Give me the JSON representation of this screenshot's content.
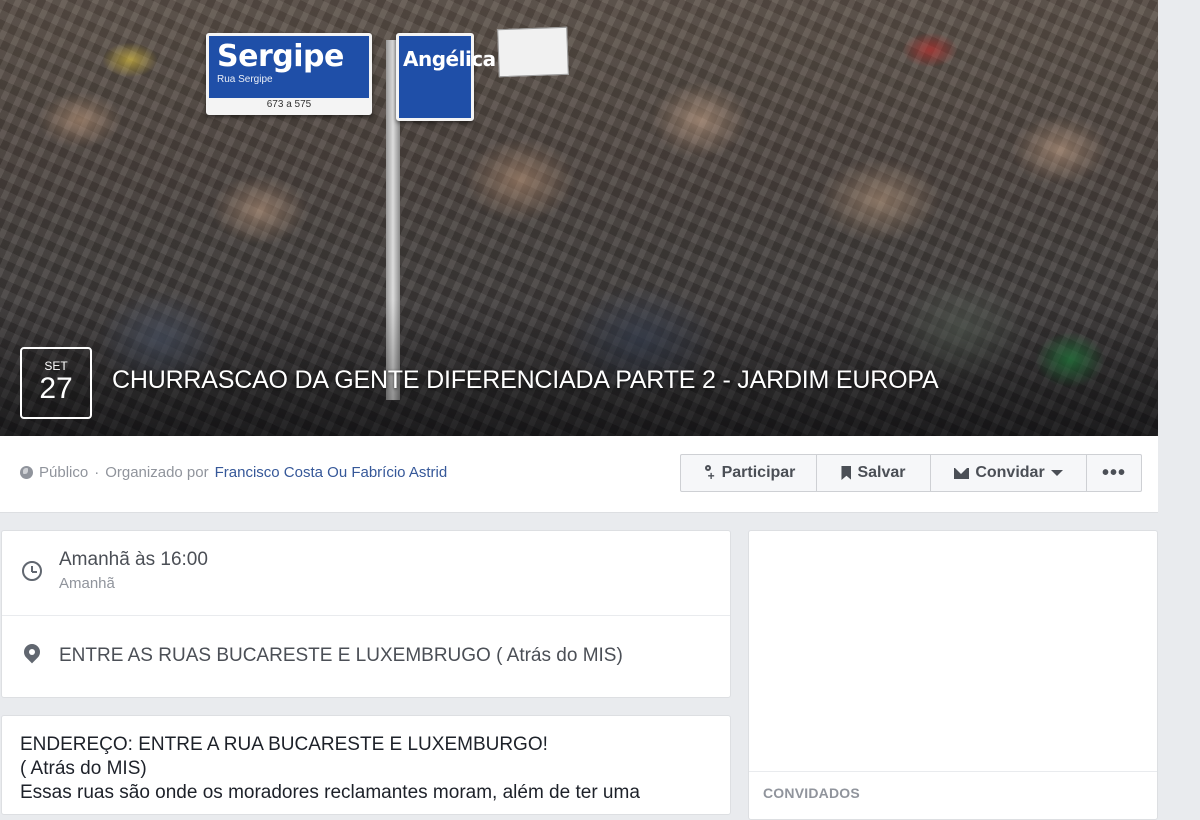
{
  "cover": {
    "signs": {
      "sergipe_name": "Sergipe",
      "sergipe_sub": "Rua Sergipe",
      "sergipe_num": "673 a 575",
      "angelica_name": "Angélica"
    },
    "date": {
      "month": "SET",
      "day": "27"
    },
    "title": "CHURRASCAO DA GENTE DIFERENCIADA PARTE 2 - JARDIM EUROPA"
  },
  "meta": {
    "privacy": "Público",
    "separator": " · ",
    "organized_by_label": "Organizado por ",
    "organizer": "Francisco Costa Ou Fabrício Astrid"
  },
  "actions": {
    "participate": "Participar",
    "save": "Salvar",
    "invite": "Convidar",
    "more": "•••"
  },
  "details": {
    "time_main": "Amanhã às 16:00",
    "time_sub": "Amanhã",
    "place": "ENTRE AS RUAS BUCARESTE E LUXEMBRUGO ( Atrás do MIS)"
  },
  "description": {
    "line1": "ENDEREÇO: ENTRE A RUA BUCARESTE E LUXEMBURGO!",
    "line2": "( Atrás do MIS)",
    "line3": "Essas ruas são onde os moradores reclamantes moram, além de ter uma"
  },
  "sidebar": {
    "guests_label": "CONVIDADOS"
  },
  "colors": {
    "link": "#365899",
    "muted": "#90949c",
    "background": "#e9ebee",
    "sign_blue": "#1f4fa8"
  }
}
